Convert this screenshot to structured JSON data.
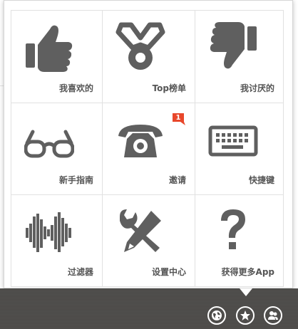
{
  "menu": {
    "tiles": [
      {
        "label": "我喜欢的",
        "icon": "thumbs-up-icon"
      },
      {
        "label": "Top榜单",
        "icon": "medal-icon"
      },
      {
        "label": "我讨厌的",
        "icon": "thumbs-down-icon"
      },
      {
        "label": "新手指南",
        "icon": "glasses-icon"
      },
      {
        "label": "邀请",
        "icon": "telephone-icon",
        "badge": "1"
      },
      {
        "label": "快捷键",
        "icon": "keyboard-icon"
      },
      {
        "label": "过滤器",
        "icon": "waveform-icon"
      },
      {
        "label": "设置中心",
        "icon": "tools-icon"
      },
      {
        "label": "获得更多App",
        "icon": "question-mark-icon"
      }
    ]
  },
  "taskbar": {
    "buttons": [
      {
        "icon": "globe-icon"
      },
      {
        "icon": "star-icon"
      },
      {
        "icon": "users-icon"
      }
    ]
  },
  "colors": {
    "icon": "#5f5f5f",
    "label": "#555555",
    "badge": "#e8472b",
    "taskbar": "#4e4c4a"
  }
}
